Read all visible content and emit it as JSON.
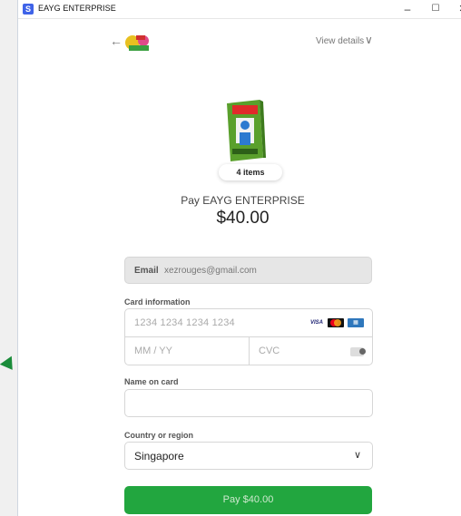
{
  "window": {
    "title": "EAYG ENTERPRISE",
    "app_icon_letter": "S"
  },
  "controls": {
    "minimize": "–",
    "maximize": "☐",
    "close": "✕"
  },
  "header": {
    "back_glyph": "←",
    "view_details": "View details",
    "chevron": "∨"
  },
  "order": {
    "items_label": "4 items",
    "pay_to": "Pay EAYG ENTERPRISE",
    "amount": "$40.00"
  },
  "email": {
    "label": "Email",
    "value": "xezrouges@gmail.com"
  },
  "card": {
    "label": "Card information",
    "number_placeholder": "1234 1234 1234 1234",
    "expiry_placeholder": "MM / YY",
    "cvc_placeholder": "CVC",
    "brands": [
      "VISA",
      "Mastercard",
      "AMEX"
    ]
  },
  "name": {
    "label": "Name on card",
    "value": ""
  },
  "country": {
    "label": "Country or region",
    "value": "Singapore",
    "chevron": "∨"
  },
  "pay_button": {
    "label": "Pay $40.00"
  },
  "colors": {
    "accent": "#22a63f",
    "app_icon": "#3f63e8",
    "arrow_mark": "#1a8c3a"
  }
}
